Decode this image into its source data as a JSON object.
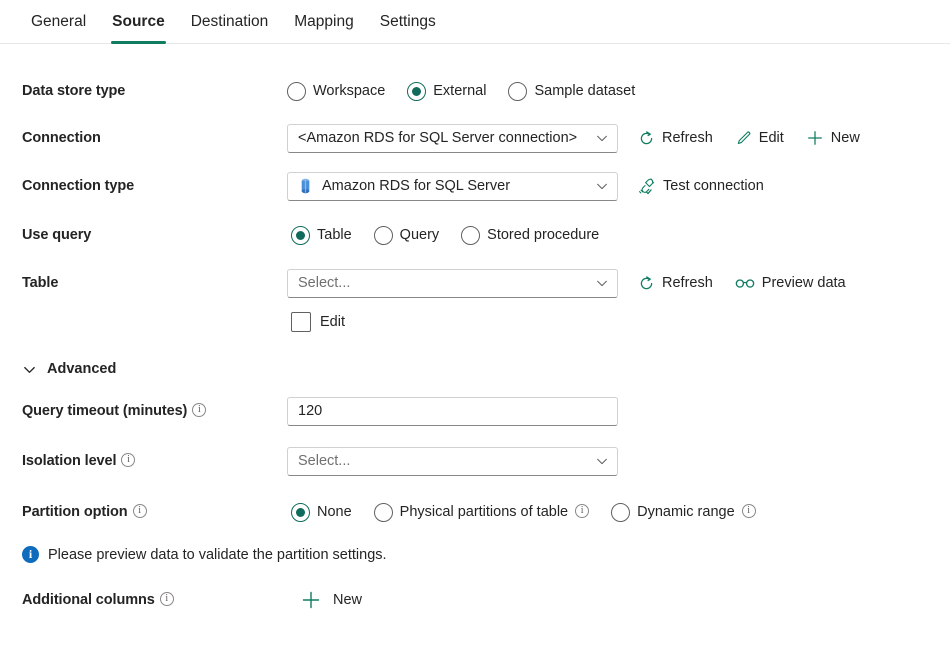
{
  "tabs": [
    {
      "label": "General",
      "active": false
    },
    {
      "label": "Source",
      "active": true
    },
    {
      "label": "Destination",
      "active": false
    },
    {
      "label": "Mapping",
      "active": false
    },
    {
      "label": "Settings",
      "active": false
    }
  ],
  "colors": {
    "accent_teal": "#107c60",
    "radio_selected": "#0f6c5c",
    "info_blue": "#0f6cbd",
    "db_icon_blue": "#4a90d9",
    "text": "#242424",
    "placeholder": "#707070",
    "border": "#d1d1d1"
  },
  "form": {
    "data_store_type": {
      "label": "Data store type",
      "options": [
        {
          "label": "Workspace",
          "selected": false
        },
        {
          "label": "External",
          "selected": true
        },
        {
          "label": "Sample dataset",
          "selected": false
        }
      ]
    },
    "connection": {
      "label": "Connection",
      "value": "<Amazon RDS for SQL Server connection>",
      "is_placeholder": false,
      "commands": [
        {
          "label": "Refresh",
          "icon": "refresh-icon"
        },
        {
          "label": "Edit",
          "icon": "pencil-icon"
        },
        {
          "label": "New",
          "icon": "plus-icon"
        }
      ]
    },
    "connection_type": {
      "label": "Connection type",
      "value": "Amazon RDS for SQL Server",
      "icon": "database-icon",
      "commands": [
        {
          "label": "Test connection",
          "icon": "plug-check-icon"
        }
      ]
    },
    "use_query": {
      "label": "Use query",
      "options": [
        {
          "label": "Table",
          "selected": true
        },
        {
          "label": "Query",
          "selected": false
        },
        {
          "label": "Stored procedure",
          "selected": false
        }
      ]
    },
    "table": {
      "label": "Table",
      "value": "Select...",
      "is_placeholder": true,
      "commands": [
        {
          "label": "Refresh",
          "icon": "refresh-icon"
        },
        {
          "label": "Preview data",
          "icon": "glasses-icon"
        }
      ],
      "edit_checkbox": {
        "label": "Edit",
        "checked": false
      }
    },
    "advanced": {
      "label": "Advanced",
      "expanded": true
    },
    "query_timeout": {
      "label": "Query timeout (minutes)",
      "has_info": true,
      "value": "120",
      "is_placeholder": false
    },
    "isolation_level": {
      "label": "Isolation level",
      "has_info": true,
      "value": "Select...",
      "is_placeholder": true
    },
    "partition_option": {
      "label": "Partition option",
      "has_info": true,
      "options": [
        {
          "label": "None",
          "selected": true,
          "has_info": false
        },
        {
          "label": "Physical partitions of table",
          "selected": false,
          "has_info": true
        },
        {
          "label": "Dynamic range",
          "selected": false,
          "has_info": true
        }
      ]
    },
    "message": {
      "icon": "info-filled-icon",
      "text": "Please preview data to validate the partition settings."
    },
    "additional_columns": {
      "label": "Additional columns",
      "has_info": true,
      "commands": [
        {
          "label": "New",
          "icon": "plus-icon"
        }
      ]
    }
  }
}
